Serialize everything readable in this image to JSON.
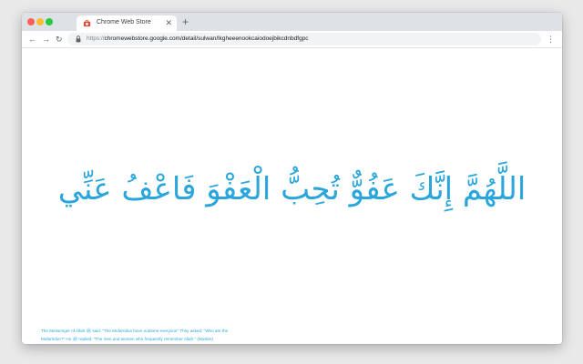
{
  "colors": {
    "traffic_red": "#ff5f57",
    "traffic_yellow": "#febc2e",
    "traffic_green": "#28c840",
    "accent_text": "#2aa6dc",
    "favicon": "#dd4b39"
  },
  "browser": {
    "tab": {
      "title": "Chrome Web Store",
      "favicon": "chrome-web-store-icon",
      "close_glyph": "✕"
    },
    "new_tab_glyph": "+",
    "nav": {
      "back_glyph": "←",
      "forward_glyph": "→",
      "reload_glyph": "↻"
    },
    "address": {
      "scheme": "https://",
      "rest": "chromewebstore.google.com/detail/sulwan/lkgheeenookcaiodoejbikcdnbdfgpc"
    },
    "menu_glyph": "⋮"
  },
  "page": {
    "dua": "اللَّهُمَّ إِنَّكَ عَفُوٌّ تُحِبُّ الْعَفْوَ فَاعْفُ عَنِّي",
    "hadith": "The Messenger of Allah ﷺ said: \"The Mufarridun have outdone everyone\" They asked: \"Who are the Mufarridun?\" He ﷺ replied: \"The men and women who frequently remember Allah.\" (Muslim)"
  }
}
